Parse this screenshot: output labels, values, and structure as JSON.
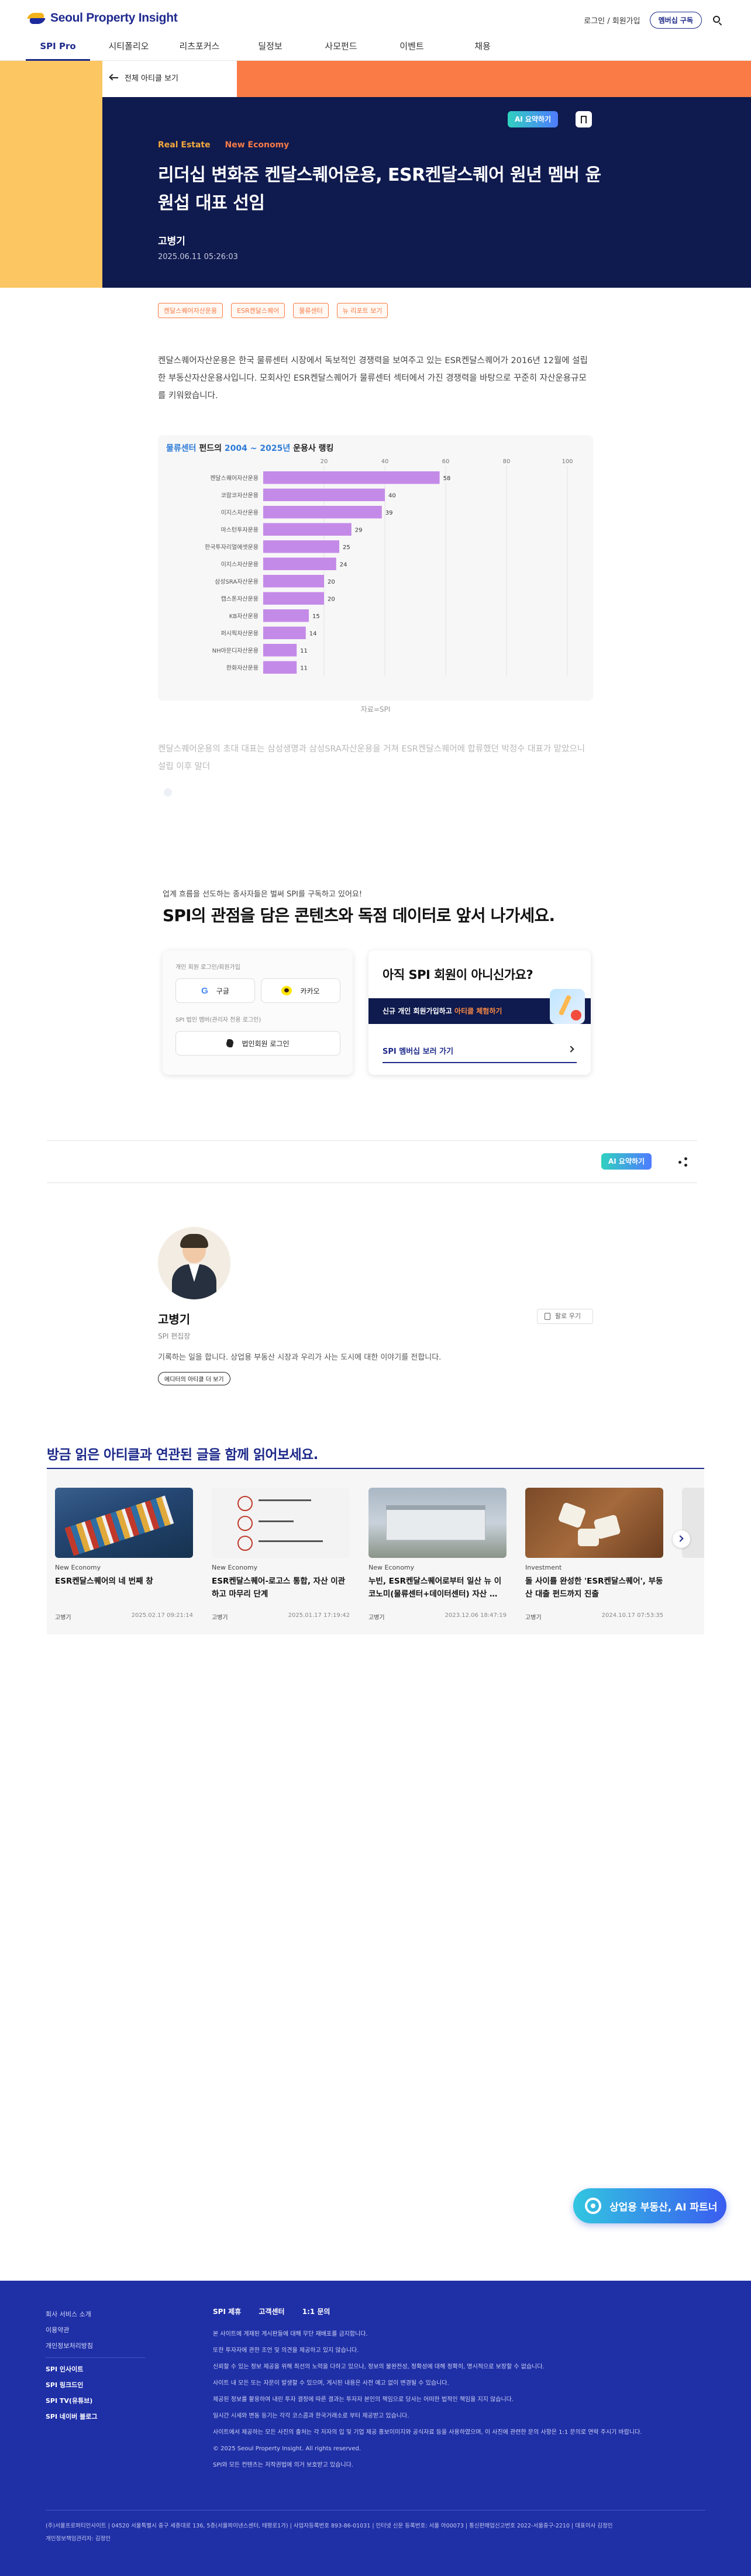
{
  "header": {
    "logo_text": "Seoul Property Insight",
    "login_label": "로그인 / 회원가입",
    "subscribe_label": "멤버십 구독",
    "search_icon": "search-icon"
  },
  "nav": [
    "SPI Pro",
    "시티폴리오",
    "리츠포커스",
    "딜정보",
    "사모펀드",
    "이벤트",
    "채용"
  ],
  "hero": {
    "back_label": "전체 아티클 보기",
    "ai_summary_label": "AI 요약하기",
    "category_1": "Real Estate",
    "category_2": "New Economy",
    "title": "리더십 변화준 켄달스퀘어운용, ESR켄달스퀘어 원년 멤버 윤원섭 대표 선임",
    "author": "고병기",
    "date": "2025.06.11 05:26:03",
    "colors": {
      "yellow": "#fcc663",
      "orange": "#fa7b45",
      "navy": "#0f1a4e"
    }
  },
  "tags": [
    "켄달스퀘어자산운용",
    "ESR켄달스퀘어",
    "물류센터",
    "뉴 리포트 보기"
  ],
  "article": {
    "paragraph_1": "켄달스퀘어자산운용은 한국 물류센터 시장에서 독보적인 경쟁력을 보여주고 있는 ESR켄달스퀘어가 2016년 12월에 설립한 부동산자산운용사입니다. 모회사인 ESR켄달스퀘어가 물류센터 섹터에서 가진 경쟁력을 바탕으로 꾸준히 자산운용규모를 키워왔습니다.",
    "chart_caption": "자료=SPI",
    "paragraph_2": "켄달스퀘어운용의 초대 대표는 삼성생명과 삼성SRA자산운용을 거쳐 ESR켄달스퀘어에 합류했던 박정수 대표가 맡았으니 설립 이후 말더"
  },
  "chart_data": {
    "type": "bar",
    "orientation": "horizontal",
    "title_highlight": "물류센터",
    "title_rest": " 펀드의 ",
    "title_years": "2004 ~ 2025년",
    "title_tail": " 운용사 랭킹",
    "categories": [
      "켄달스퀘어자산운용",
      "코람코자산운용",
      "이지스자산운용",
      "마스턴투자운용",
      "한국투자리얼에셋운용",
      "이지스자산운용",
      "삼성SRA자산운용",
      "캡스톤자산운용",
      "KB자산운용",
      "퍼시픽자산운용",
      "NH아문디자산운용",
      "한화자산운용"
    ],
    "values": [
      58,
      40,
      39,
      29,
      25,
      24,
      20,
      20,
      15,
      14,
      11,
      11
    ],
    "x_ticks": [
      20,
      40,
      60,
      80,
      100
    ],
    "xlim": [
      0,
      100
    ],
    "bar_color": "#c48ae8",
    "grid": true
  },
  "paywall": {
    "subtitle": "업계 흐름을 선도하는 종사자들은 벌써 SPI를 구독하고 있어요!",
    "title": "SPI의 관점을 담은 콘텐츠와 독점 데이터로 앞서 나가세요.",
    "personal_label": "개인 회원 로그인/회원가입",
    "google_label": "구글",
    "kakao_label": "카카오",
    "corporate_label": "SPI 법인 멤버(관리자 전용 로그인)",
    "corporate_btn": "법인회원 로그인",
    "join_title": "아직 SPI 회원이 아니신가요?",
    "join_banner_1": "신규 개인 회원가입하고 ",
    "join_banner_hl": "아티클 체험하기",
    "join_link": "SPI 멤버십 보러 가기"
  },
  "share": {
    "ai_summary_label": "AI 요약하기"
  },
  "author_box": {
    "name": "고병기",
    "role": "SPI 편집장",
    "bio": "기록하는 일을 합니다. 상업용 부동산 시장과 우리가 사는 도시에 대한 이야기를 전합니다.",
    "more_label": "에디터의 아티클 더 보기",
    "follow_label": "팔로 우기"
  },
  "related": {
    "title": "방금 읽은 아티클과 연관된 글을 함께 읽어보세요.",
    "items": [
      {
        "category": "New Economy",
        "title": "ESR켄달스퀘어의 네 번째 창",
        "author": "고병기",
        "date": "2025.02.17 09:21:14"
      },
      {
        "category": "New Economy",
        "title": "ESR켄달스퀘어-로고스 통합, 자산 이관하고 마무리 단계",
        "author": "고병기",
        "date": "2025.01.17 17:19:42"
      },
      {
        "category": "New Economy",
        "title": "누빈, ESR켄달스퀘어로부터 일산 뉴 이코노미(물류센터+데이터센터) 자산 …",
        "author": "고병기",
        "date": "2023.12.06 18:47:19"
      },
      {
        "category": "Investment",
        "title": "돌 사이를 완성한 'ESR켄달스퀘어', 부동산 대출 펀드까지 진출",
        "author": "고병기",
        "date": "2024.10.17 07:53:35"
      }
    ]
  },
  "floating_cta": "상업용 부동산, AI 파트너",
  "footer": {
    "links": [
      "회사 서비스 소개",
      "이용약관",
      "개인정보처리방침"
    ],
    "links_bold": [
      "SPI 인사이트",
      "SPI 링크드인",
      "SPI TV(유튜브)",
      "SPI 네이버 블로그"
    ],
    "tabs": [
      "SPI 제휴",
      "고객센터",
      "1:1 문의"
    ],
    "notes": [
      "본 사이트에 게재된 게시판들에 대해 무단 재배포를 금지합니다.",
      "또한 투자자에 관한 조언 및 의견을 제공하고 있지 않습니다.",
      "신뢰할 수 있는 정보 제공을 위해 최선의 노력을 다하고 있으나, 정보의 불완전성, 정확성에 대해 정확히, 명시적으로 보장할 수 없습니다.",
      "사이트 내 모든 또는 자문이 발생할 수 있으며, 게시된 내용은 사전 예고 없이 변경될 수 있습니다.",
      "제공된 정보를 활용하여 내린 투자 결정에 따른 결과는 투자자 본인의 책임으로 당사는 어떠한 법적인 책임을 지지 않습니다.",
      "일시간 시세와 변동 등기는 각각 코스콤과 한국거래소로 부터 제공받고 있습니다.",
      "사이트에서 제공하는 모든 사진의 출처는 각 저자의 입 및 기업 제공 홍보이미지와 공식자료 등을 사용하였으며, 이 사진에 관련한 문의 사항은 1:1 문의로 연락 주시기 바랍니다.",
      "© 2025 Seoul Property Insight. All rights reserved.",
      "SPI와 모든 컨텐츠는 저작권법에 의거 보호받고 있습니다."
    ],
    "company_info": "(주)서울프로퍼티인사이트 | 04520 서울특별시 중구 세종대로 136, 5층(서울파이낸스센터, 태평로1가) | 사업자등록번호 893-86-01031 | 인터넷 신문 등록번호: 서울 아00073 | 통신판매업신고번호 2022-서울중구-2210 | 대표이사 김정인",
    "privacy_officer": "개인정보책임관리자: 김정인"
  }
}
